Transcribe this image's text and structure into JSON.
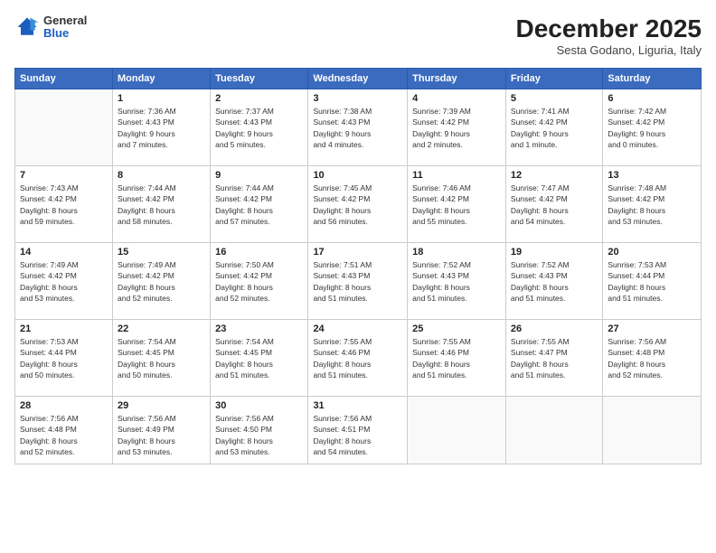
{
  "logo": {
    "general": "General",
    "blue": "Blue"
  },
  "title": "December 2025",
  "subtitle": "Sesta Godano, Liguria, Italy",
  "weekdays": [
    "Sunday",
    "Monday",
    "Tuesday",
    "Wednesday",
    "Thursday",
    "Friday",
    "Saturday"
  ],
  "weeks": [
    [
      {
        "day": "",
        "info": ""
      },
      {
        "day": "1",
        "info": "Sunrise: 7:36 AM\nSunset: 4:43 PM\nDaylight: 9 hours\nand 7 minutes."
      },
      {
        "day": "2",
        "info": "Sunrise: 7:37 AM\nSunset: 4:43 PM\nDaylight: 9 hours\nand 5 minutes."
      },
      {
        "day": "3",
        "info": "Sunrise: 7:38 AM\nSunset: 4:43 PM\nDaylight: 9 hours\nand 4 minutes."
      },
      {
        "day": "4",
        "info": "Sunrise: 7:39 AM\nSunset: 4:42 PM\nDaylight: 9 hours\nand 2 minutes."
      },
      {
        "day": "5",
        "info": "Sunrise: 7:41 AM\nSunset: 4:42 PM\nDaylight: 9 hours\nand 1 minute."
      },
      {
        "day": "6",
        "info": "Sunrise: 7:42 AM\nSunset: 4:42 PM\nDaylight: 9 hours\nand 0 minutes."
      }
    ],
    [
      {
        "day": "7",
        "info": "Sunrise: 7:43 AM\nSunset: 4:42 PM\nDaylight: 8 hours\nand 59 minutes."
      },
      {
        "day": "8",
        "info": "Sunrise: 7:44 AM\nSunset: 4:42 PM\nDaylight: 8 hours\nand 58 minutes."
      },
      {
        "day": "9",
        "info": "Sunrise: 7:44 AM\nSunset: 4:42 PM\nDaylight: 8 hours\nand 57 minutes."
      },
      {
        "day": "10",
        "info": "Sunrise: 7:45 AM\nSunset: 4:42 PM\nDaylight: 8 hours\nand 56 minutes."
      },
      {
        "day": "11",
        "info": "Sunrise: 7:46 AM\nSunset: 4:42 PM\nDaylight: 8 hours\nand 55 minutes."
      },
      {
        "day": "12",
        "info": "Sunrise: 7:47 AM\nSunset: 4:42 PM\nDaylight: 8 hours\nand 54 minutes."
      },
      {
        "day": "13",
        "info": "Sunrise: 7:48 AM\nSunset: 4:42 PM\nDaylight: 8 hours\nand 53 minutes."
      }
    ],
    [
      {
        "day": "14",
        "info": "Sunrise: 7:49 AM\nSunset: 4:42 PM\nDaylight: 8 hours\nand 53 minutes."
      },
      {
        "day": "15",
        "info": "Sunrise: 7:49 AM\nSunset: 4:42 PM\nDaylight: 8 hours\nand 52 minutes."
      },
      {
        "day": "16",
        "info": "Sunrise: 7:50 AM\nSunset: 4:42 PM\nDaylight: 8 hours\nand 52 minutes."
      },
      {
        "day": "17",
        "info": "Sunrise: 7:51 AM\nSunset: 4:43 PM\nDaylight: 8 hours\nand 51 minutes."
      },
      {
        "day": "18",
        "info": "Sunrise: 7:52 AM\nSunset: 4:43 PM\nDaylight: 8 hours\nand 51 minutes."
      },
      {
        "day": "19",
        "info": "Sunrise: 7:52 AM\nSunset: 4:43 PM\nDaylight: 8 hours\nand 51 minutes."
      },
      {
        "day": "20",
        "info": "Sunrise: 7:53 AM\nSunset: 4:44 PM\nDaylight: 8 hours\nand 51 minutes."
      }
    ],
    [
      {
        "day": "21",
        "info": "Sunrise: 7:53 AM\nSunset: 4:44 PM\nDaylight: 8 hours\nand 50 minutes."
      },
      {
        "day": "22",
        "info": "Sunrise: 7:54 AM\nSunset: 4:45 PM\nDaylight: 8 hours\nand 50 minutes."
      },
      {
        "day": "23",
        "info": "Sunrise: 7:54 AM\nSunset: 4:45 PM\nDaylight: 8 hours\nand 51 minutes."
      },
      {
        "day": "24",
        "info": "Sunrise: 7:55 AM\nSunset: 4:46 PM\nDaylight: 8 hours\nand 51 minutes."
      },
      {
        "day": "25",
        "info": "Sunrise: 7:55 AM\nSunset: 4:46 PM\nDaylight: 8 hours\nand 51 minutes."
      },
      {
        "day": "26",
        "info": "Sunrise: 7:55 AM\nSunset: 4:47 PM\nDaylight: 8 hours\nand 51 minutes."
      },
      {
        "day": "27",
        "info": "Sunrise: 7:56 AM\nSunset: 4:48 PM\nDaylight: 8 hours\nand 52 minutes."
      }
    ],
    [
      {
        "day": "28",
        "info": "Sunrise: 7:56 AM\nSunset: 4:48 PM\nDaylight: 8 hours\nand 52 minutes."
      },
      {
        "day": "29",
        "info": "Sunrise: 7:56 AM\nSunset: 4:49 PM\nDaylight: 8 hours\nand 53 minutes."
      },
      {
        "day": "30",
        "info": "Sunrise: 7:56 AM\nSunset: 4:50 PM\nDaylight: 8 hours\nand 53 minutes."
      },
      {
        "day": "31",
        "info": "Sunrise: 7:56 AM\nSunset: 4:51 PM\nDaylight: 8 hours\nand 54 minutes."
      },
      {
        "day": "",
        "info": ""
      },
      {
        "day": "",
        "info": ""
      },
      {
        "day": "",
        "info": ""
      }
    ]
  ]
}
